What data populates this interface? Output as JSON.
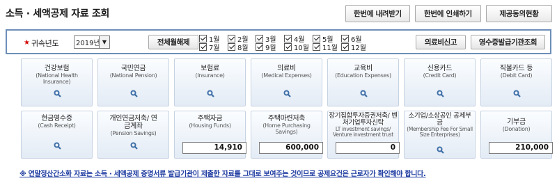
{
  "header": {
    "title": "소득 · 세액공제 자료 조회",
    "buttons": [
      "한번에 내려받기",
      "한번에 인쇄하기",
      "제공동의현황"
    ]
  },
  "filter": {
    "year_label": "귀속년도",
    "year_value": "2019년",
    "toggle_all_label": "전체월해제",
    "months": [
      {
        "label": "1월",
        "checked": true
      },
      {
        "label": "2월",
        "checked": true
      },
      {
        "label": "3월",
        "checked": true
      },
      {
        "label": "4월",
        "checked": true
      },
      {
        "label": "5월",
        "checked": true
      },
      {
        "label": "6월",
        "checked": true
      },
      {
        "label": "7월",
        "checked": true
      },
      {
        "label": "8월",
        "checked": true
      },
      {
        "label": "9월",
        "checked": true
      },
      {
        "label": "10월",
        "checked": true
      },
      {
        "label": "11월",
        "checked": true
      },
      {
        "label": "12월",
        "checked": true
      }
    ],
    "medical_report_label": "의료비신고",
    "receipt_issuer_label": "영수증발급기관조회"
  },
  "categories": {
    "row1": [
      {
        "name": "건강보험",
        "sub": "(National Health Insurance)"
      },
      {
        "name": "국민연금",
        "sub": "(National Pension)"
      },
      {
        "name": "보험료",
        "sub": "(Insurance)"
      },
      {
        "name": "의료비",
        "sub": "(Medical Expenses)"
      },
      {
        "name": "교육비",
        "sub": "(Education Expenses)"
      },
      {
        "name": "신용카드",
        "sub": "(Credit Card)"
      },
      {
        "name": "직불카드 등",
        "sub": "(Debit Card)"
      }
    ],
    "row2": [
      {
        "name": "현금영수증",
        "sub": "(Cash Receipt)"
      },
      {
        "name": "개인연금저축/ 연금계좌",
        "sub": "(Pension Savings)"
      },
      {
        "name": "주택자금",
        "sub": "(Housing Funds)",
        "amount": "14,910"
      },
      {
        "name": "주택마련저축",
        "sub": "(Home Purchasing Savings)",
        "amount": "600,000"
      },
      {
        "name": "장기집합투자증권저축/ 벤처기업투자신탁",
        "sub": "LT investment savings/ Venture investment trust",
        "amount": "0"
      },
      {
        "name": "소기업/소상공인 공제부금",
        "sub": "(Membership Fee For Small Size Enterprises)"
      },
      {
        "name": "기부금",
        "sub": "(Donation)",
        "amount": "210,000"
      }
    ]
  },
  "notice": "※ 연말정산간소화 자료는 소득 · 세액공제 증명서류 발급기관이 제출한 자료를 그대로 보여주는 것이므로 공제요건은 근로자가 확인해야 합니다.",
  "colors": {
    "accent_border": "#6d8fb8",
    "notice": "#1c3aa0",
    "required_star": "#d40000"
  }
}
